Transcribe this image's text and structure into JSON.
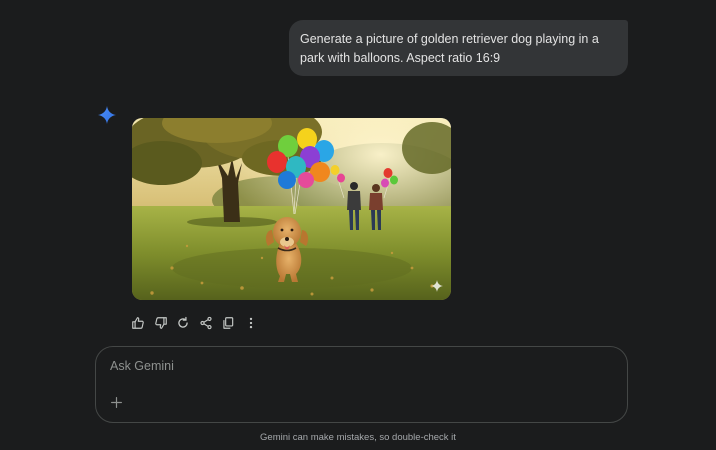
{
  "conversation": {
    "user_prompt": "Generate a picture of golden retriever dog playing in a park with balloons. Aspect ratio 16:9"
  },
  "response": {
    "avatar_icon": "gemini-sparkle-icon",
    "image_badge_icon": "sparkle-icon",
    "actions": [
      {
        "icon": "thumbs-up-icon"
      },
      {
        "icon": "thumbs-down-icon"
      },
      {
        "icon": "redo-icon"
      },
      {
        "icon": "share-icon"
      },
      {
        "icon": "copy-icon"
      },
      {
        "icon": "more-vert-icon"
      }
    ]
  },
  "composer": {
    "placeholder": "Ask Gemini",
    "add_icon": "plus-icon"
  },
  "footer": {
    "disclaimer": "Gemini can make mistakes, so double-check it"
  },
  "colors": {
    "background": "#1b1c1d",
    "user_bubble": "#333537",
    "text": "#e3e3e3",
    "muted_text": "#8e918f",
    "gemini_blue": "#4285f4"
  }
}
